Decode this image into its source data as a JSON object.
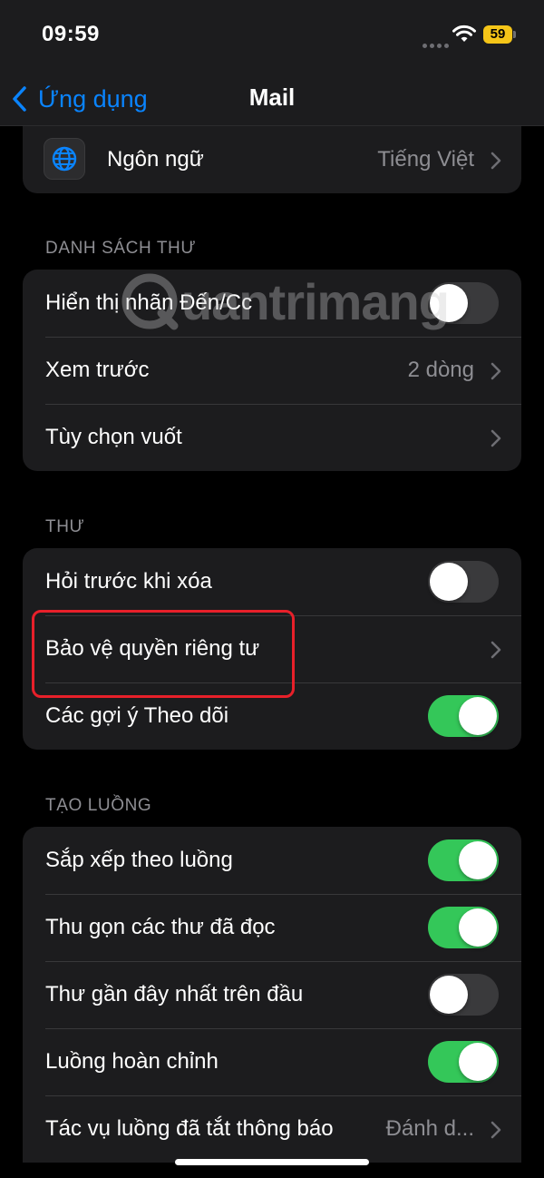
{
  "status_bar": {
    "time": "09:59",
    "battery": "59"
  },
  "nav": {
    "back_label": "Ứng dụng",
    "title": "Mail"
  },
  "language": {
    "label": "Ngôn ngữ",
    "value": "Tiếng Việt"
  },
  "sections": {
    "message_list": {
      "header": "DANH SÁCH THƯ",
      "rows": [
        {
          "label": "Hiển thị nhãn Đến/Cc",
          "toggle": false
        },
        {
          "label": "Xem trước",
          "value": "2 dòng"
        },
        {
          "label": "Tùy chọn vuốt"
        }
      ]
    },
    "messages": {
      "header": "THƯ",
      "rows": [
        {
          "label": "Hỏi trước khi xóa",
          "toggle": false
        },
        {
          "label": "Bảo vệ quyền riêng tư"
        },
        {
          "label": "Các gợi ý Theo dõi",
          "toggle": true
        }
      ]
    },
    "threading": {
      "header": "TẠO LUỒNG",
      "rows": [
        {
          "label": "Sắp xếp theo luồng",
          "toggle": true
        },
        {
          "label": "Thu gọn các thư đã đọc",
          "toggle": true
        },
        {
          "label": "Thư gần đây nhất trên đầu",
          "toggle": false
        },
        {
          "label": "Luồng hoàn chỉnh",
          "toggle": true
        },
        {
          "label": "Tác vụ luồng đã tắt thông báo",
          "value": "Đánh d..."
        }
      ]
    }
  },
  "watermark": "uantrimang",
  "colors": {
    "accent": "#0a84ff",
    "toggle_on": "#34c759",
    "highlight": "#e8202a",
    "battery": "#f5c518"
  }
}
